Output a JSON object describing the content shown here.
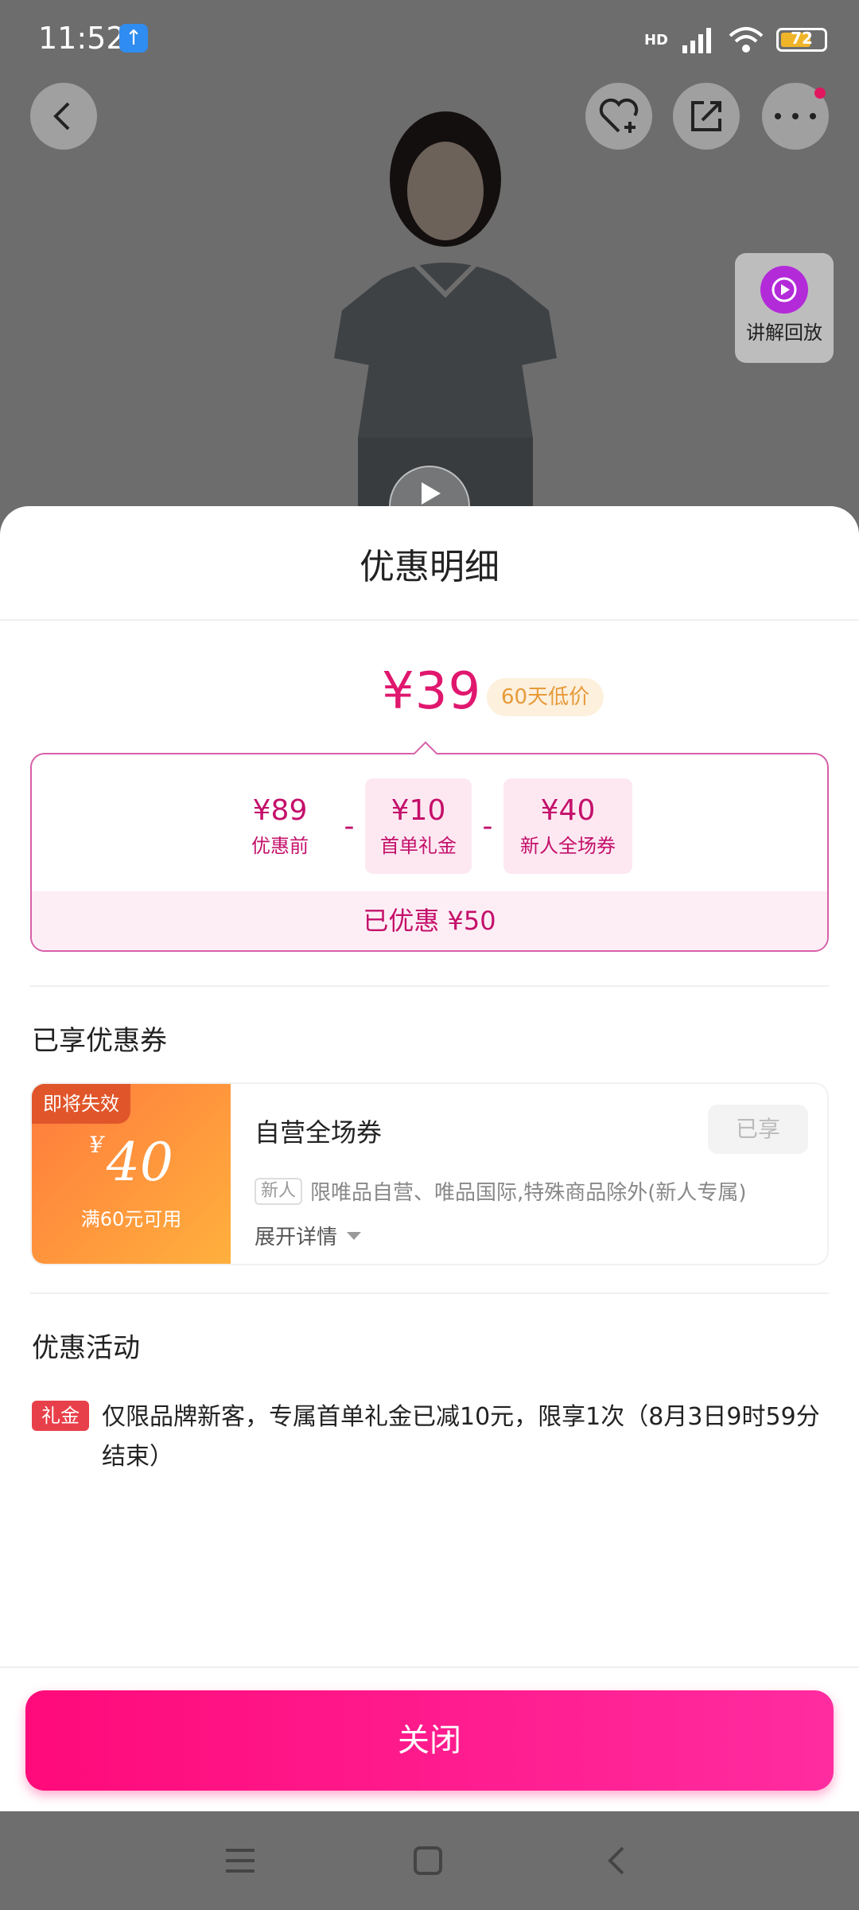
{
  "status_bar": {
    "time": "11:52",
    "network": "HD",
    "battery": "72",
    "battery_level": 0.72,
    "battery_color": "#f0b428"
  },
  "product_page": {
    "replay_label": "讲解回放",
    "icons": [
      "back-icon",
      "favorite-add-icon",
      "share-icon",
      "more-icon",
      "play-icon"
    ]
  },
  "sheet": {
    "title": "优惠明细",
    "final_price": "¥39",
    "price_tag": "60天低价",
    "breakdown": [
      {
        "value": "¥89",
        "label": "优惠前"
      },
      {
        "op": "-"
      },
      {
        "value": "¥10",
        "label": "首单礼金"
      },
      {
        "op": "-"
      },
      {
        "value": "¥40",
        "label": "新人全场券"
      }
    ],
    "saved_text": "已优惠 ¥50",
    "coupons_title": "已享优惠券",
    "coupon": {
      "expire_tag": "即将失效",
      "currency": "¥",
      "amount": "40",
      "condition": "满60元可用",
      "name": "自营全场券",
      "status": "已享",
      "new_tag": "新人",
      "description": "限唯品自营、唯品国际,特殊商品除外(新人专属)",
      "expand_label": "展开详情"
    },
    "activities_title": "优惠活动",
    "activity": {
      "tag": "礼金",
      "text": "仅限品牌新客，专属首单礼金已减10元，限享1次（8月3日9时59分结束）"
    },
    "close_label": "关闭"
  },
  "colors": {
    "accent": "#e0176e",
    "button_gradient_start": "#ff0a7a",
    "button_gradient_end": "#ff2ca0",
    "coupon_gradient_start": "#ff7a3d",
    "coupon_gradient_end": "#ffb13d"
  }
}
